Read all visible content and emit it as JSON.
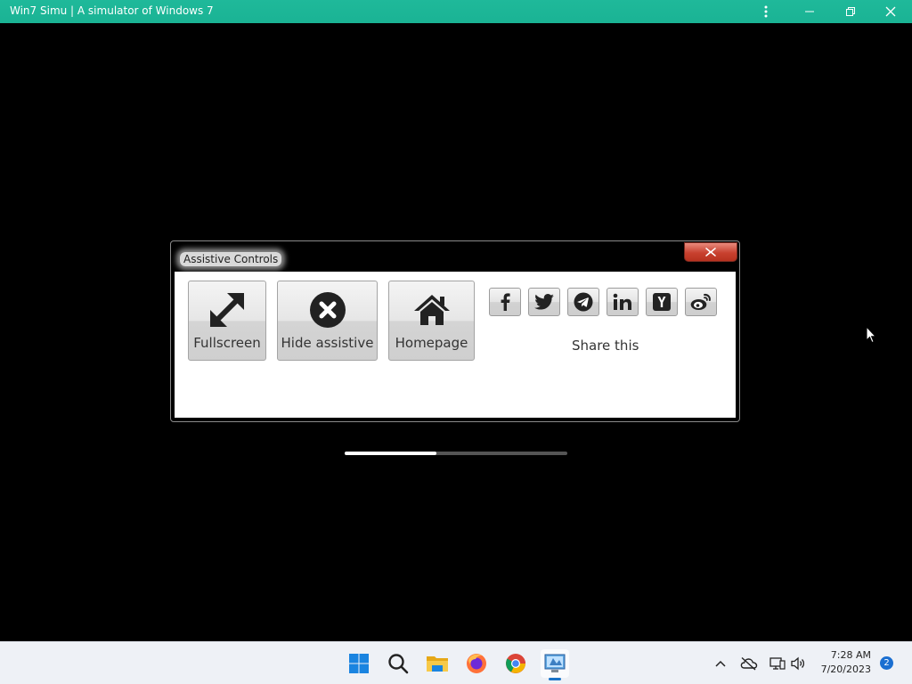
{
  "window": {
    "title": "Win7 Simu | A simulator of Windows 7",
    "accent": "#1ab394"
  },
  "dialog": {
    "title": "Assistive Controls",
    "buttons": [
      {
        "label": "Fullscreen",
        "icon": "fullscreen-arrows-icon"
      },
      {
        "label": "Hide assistive",
        "icon": "close-circle-icon"
      },
      {
        "label": "Homepage",
        "icon": "home-icon"
      }
    ],
    "share": {
      "label": "Share this",
      "icons": [
        "facebook-icon",
        "twitter-icon",
        "telegram-icon",
        "linkedin-icon",
        "hacker-news-icon",
        "weibo-icon"
      ]
    }
  },
  "progress": {
    "value": 0.41
  },
  "taskbar": {
    "apps": [
      "windows-start-icon",
      "search-icon",
      "file-explorer-icon",
      "firefox-icon",
      "chrome-icon",
      "win7-simu-app-icon"
    ],
    "time": "7:28 AM",
    "date": "7/20/2023",
    "notifications": "2"
  }
}
